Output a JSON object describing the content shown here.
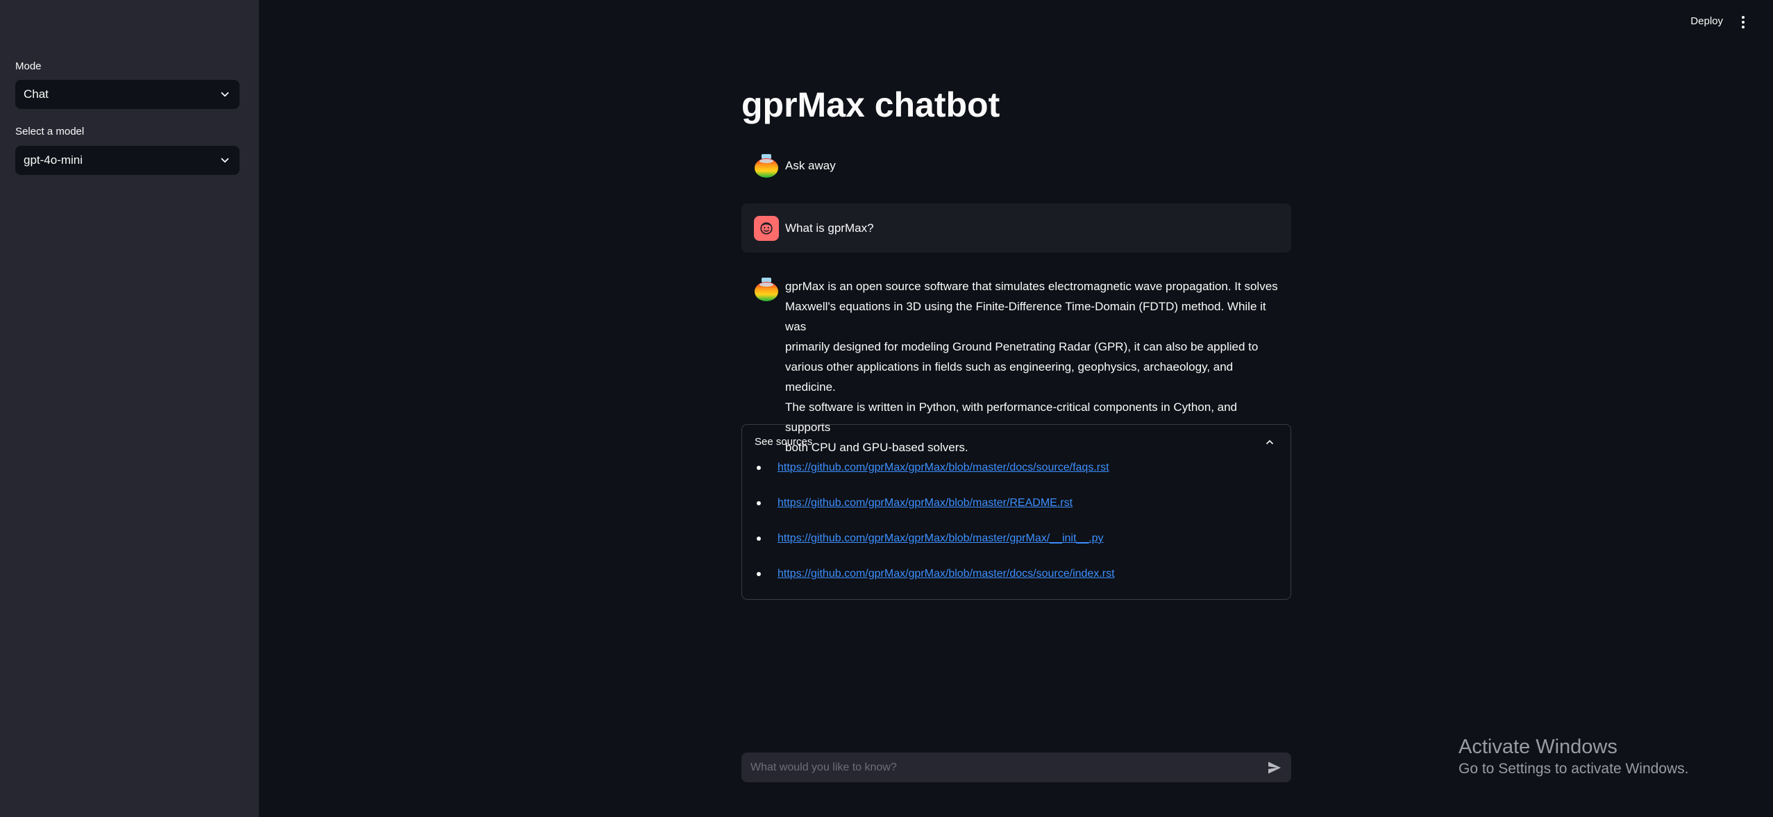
{
  "sidebar": {
    "mode_label": "Mode",
    "mode_value": "Chat",
    "model_label": "Select a model",
    "model_value": "gpt-4o-mini"
  },
  "header": {
    "deploy_label": "Deploy"
  },
  "main": {
    "title": "gprMax chatbot",
    "messages": [
      {
        "role": "assistant",
        "text": "Ask away"
      },
      {
        "role": "user",
        "text": "What is gprMax?"
      },
      {
        "role": "assistant",
        "lines": [
          "gprMax is an open source software that simulates electromagnetic wave propagation. It solves",
          "Maxwell's equations in 3D using the Finite-Difference Time-Domain (FDTD) method. While it was",
          "primarily designed for modeling Ground Penetrating Radar (GPR), it can also be applied to",
          "various other applications in fields such as engineering, geophysics, archaeology, and medicine.",
          "The software is written in Python, with performance-critical components in Cython, and supports",
          "both CPU and GPU-based solvers."
        ]
      }
    ],
    "sources": {
      "header": "See sources",
      "links": [
        "https://github.com/gprMax/gprMax/blob/master/docs/source/faqs.rst",
        "https://github.com/gprMax/gprMax/blob/master/README.rst",
        "https://github.com/gprMax/gprMax/blob/master/gprMax/__init__.py",
        "https://github.com/gprMax/gprMax/blob/master/docs/source/index.rst"
      ]
    }
  },
  "chat_input": {
    "placeholder": "What would you like to know?"
  },
  "watermark": {
    "title": "Activate Windows",
    "subtitle": "Go to Settings to activate Windows."
  },
  "colors": {
    "background": "#0e1117",
    "sidebar": "#262730",
    "link": "#3d8fff",
    "user_avatar": "#ff6c6c"
  }
}
